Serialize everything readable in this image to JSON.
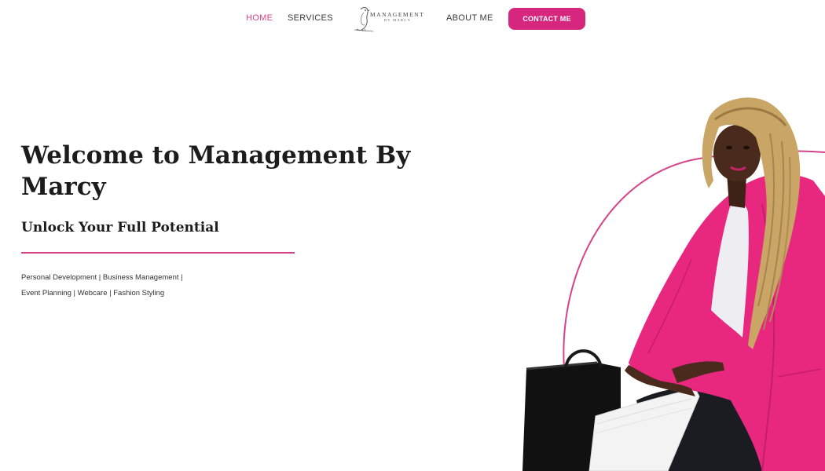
{
  "nav": {
    "items": [
      {
        "label": "HOME",
        "active": true
      },
      {
        "label": "SERVICES",
        "active": false
      },
      {
        "label": "ABOUT ME",
        "active": false
      }
    ],
    "logo": {
      "line1": "MANAGEMENT",
      "line2": "BY MARCY",
      "icon": "bird-logo-icon"
    },
    "contact_label": "CONTACT ME"
  },
  "hero": {
    "title": "Welcome to Management By Marcy",
    "subtitle": "Unlock Your Full Potential",
    "tagline_line1": "Personal Development | Business Management |",
    "tagline_line2": "Event Planning | Webcare | Fashion Styling",
    "image": "woman-in-pink-blazer-with-bags"
  },
  "colors": {
    "accent": "#d6267e",
    "accent_light": "#d6428a",
    "text": "#1c1c1c",
    "background": "#ffffff"
  }
}
